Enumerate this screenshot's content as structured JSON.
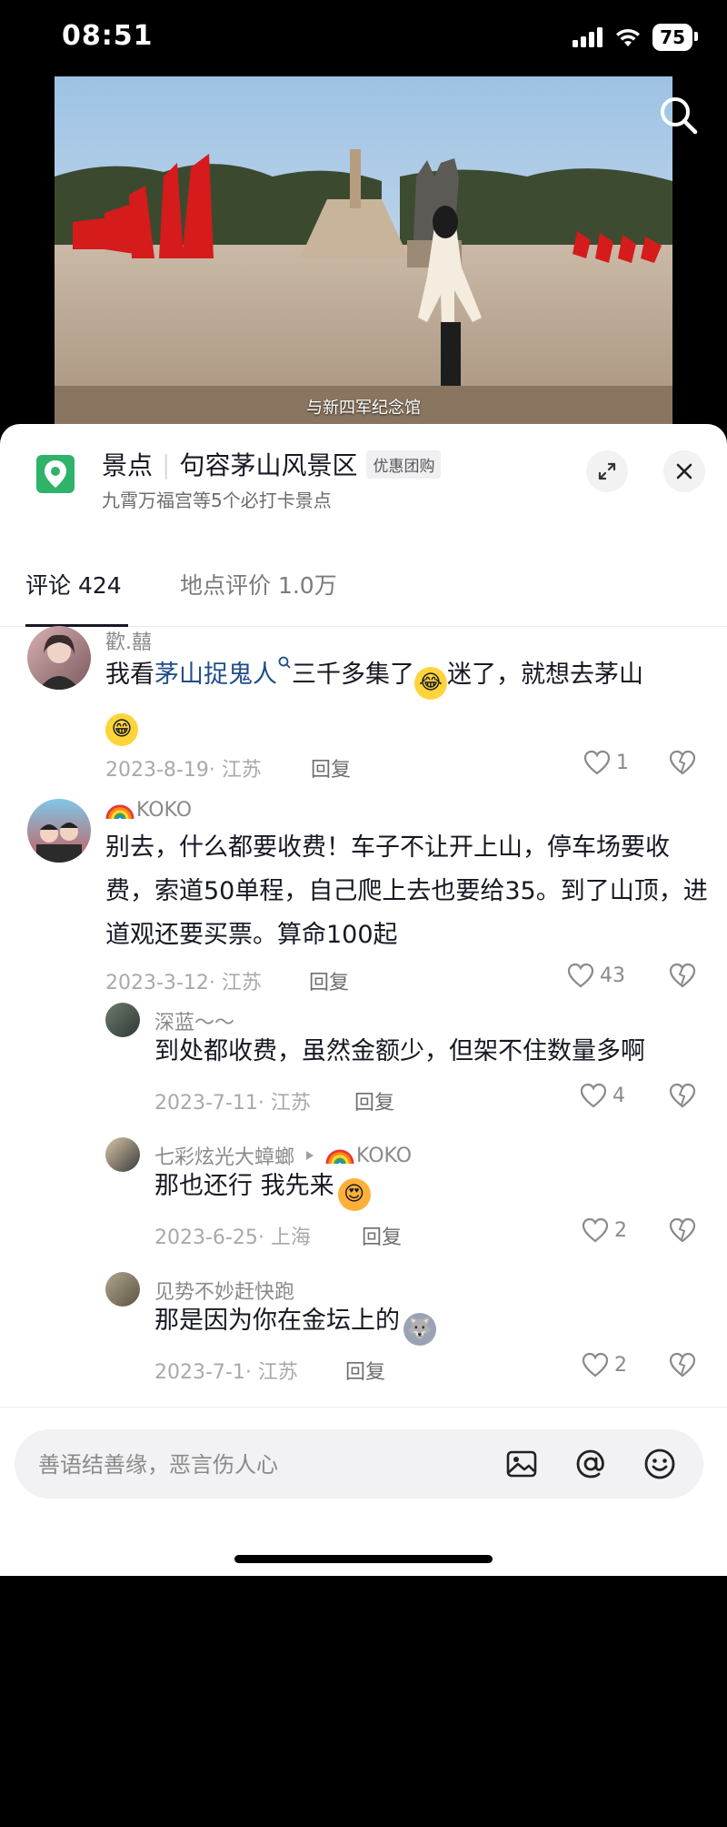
{
  "status_bar": {
    "time": "08:51",
    "battery": "75"
  },
  "video": {
    "subtitle": "与新四军纪念馆"
  },
  "place": {
    "category": "景点",
    "name": "句容茅山风景区",
    "badge": "优惠团购",
    "subtitle": "九霄万福宫等5个必打卡景点"
  },
  "tabs": [
    {
      "label": "评论 424",
      "active": true
    },
    {
      "label": "地点评价 1.0万",
      "active": false
    }
  ],
  "comments": [
    {
      "username": "歡.囍",
      "text_prefix": "我看",
      "link": "茅山捉鬼人",
      "text_suffix": "三千多集了",
      "text_after_emoji": "迷了，就想去茅山",
      "meta": "2023-8-19· 江苏",
      "reply": "回复",
      "likes": "1"
    },
    {
      "username": "KOKO",
      "text": "别去，什么都要收费！车子不让开上山，停车场要收费，索道50单程，自己爬上去也要给35。到了山顶，进道观还要买票。算命100起",
      "meta": "2023-3-12· 江苏",
      "reply": "回复",
      "likes": "43"
    }
  ],
  "replies": [
    {
      "username": "深蓝～～",
      "text": "到处都收费，虽然金额少，但架不住数量多啊",
      "meta": "2023-7-11· 江苏",
      "reply": "回复",
      "likes": "4"
    },
    {
      "username": "七彩炫光大蟑螂",
      "reply_to": "KOKO",
      "text": "那也还行 我先来",
      "meta": "2023-6-25· 上海",
      "reply": "回复",
      "likes": "2"
    },
    {
      "username": "见势不妙赶快跑",
      "text": "那是因为你在金坛上的",
      "meta": "2023-7-1· 江苏",
      "reply": "回复",
      "likes": "2"
    }
  ],
  "input": {
    "placeholder": "善语结善缘，恶言伤人心"
  },
  "icons": [
    "search-icon",
    "location-icon",
    "expand-icon",
    "close-icon",
    "heart-icon",
    "broken-heart-icon",
    "image-icon",
    "at-icon",
    "smile-icon"
  ],
  "colors": {
    "accent_link": "#1f4d8a",
    "location_green": "#2fb36a"
  }
}
